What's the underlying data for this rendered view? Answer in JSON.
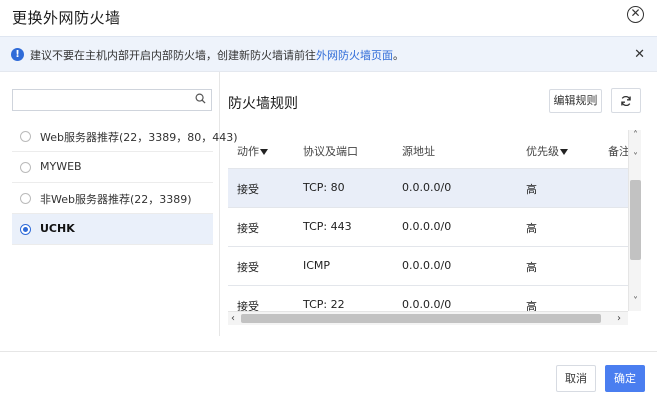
{
  "dialog": {
    "title": "更换外网防火墙"
  },
  "notice": {
    "text": "建议不要在主机内部开启内部防火墙，创建新防火墙请前往",
    "link_text": "外网防火墙页面",
    "suffix": "。"
  },
  "search": {
    "placeholder": "",
    "value": ""
  },
  "groups": [
    {
      "label": "Web服务器推荐(22，3389，80，443)",
      "selected": false
    },
    {
      "label": "MYWEB",
      "selected": false
    },
    {
      "label": "非Web服务器推荐(22，3389)",
      "selected": false
    },
    {
      "label": "UCHK",
      "selected": true
    }
  ],
  "rules_panel": {
    "title": "防火墙规则",
    "edit_button": "编辑规则"
  },
  "table": {
    "columns": [
      "动作",
      "协议及端口",
      "源地址",
      "优先级",
      "备注"
    ],
    "rows": [
      {
        "action": "接受",
        "protocol_port": "TCP: 80",
        "source": "0.0.0.0/0",
        "priority": "高"
      },
      {
        "action": "接受",
        "protocol_port": "TCP: 443",
        "source": "0.0.0.0/0",
        "priority": "高"
      },
      {
        "action": "接受",
        "protocol_port": "ICMP",
        "source": "0.0.0.0/0",
        "priority": "高"
      },
      {
        "action": "接受",
        "protocol_port": "TCP: 22",
        "source": "0.0.0.0/0",
        "priority": "高"
      }
    ]
  },
  "footer": {
    "cancel": "取消",
    "confirm": "确定"
  },
  "colors": {
    "primary": "#4a7ef0",
    "link": "#2f6bd8",
    "notice_bg": "#eef3fb",
    "row_highlight": "#e9eef8"
  }
}
